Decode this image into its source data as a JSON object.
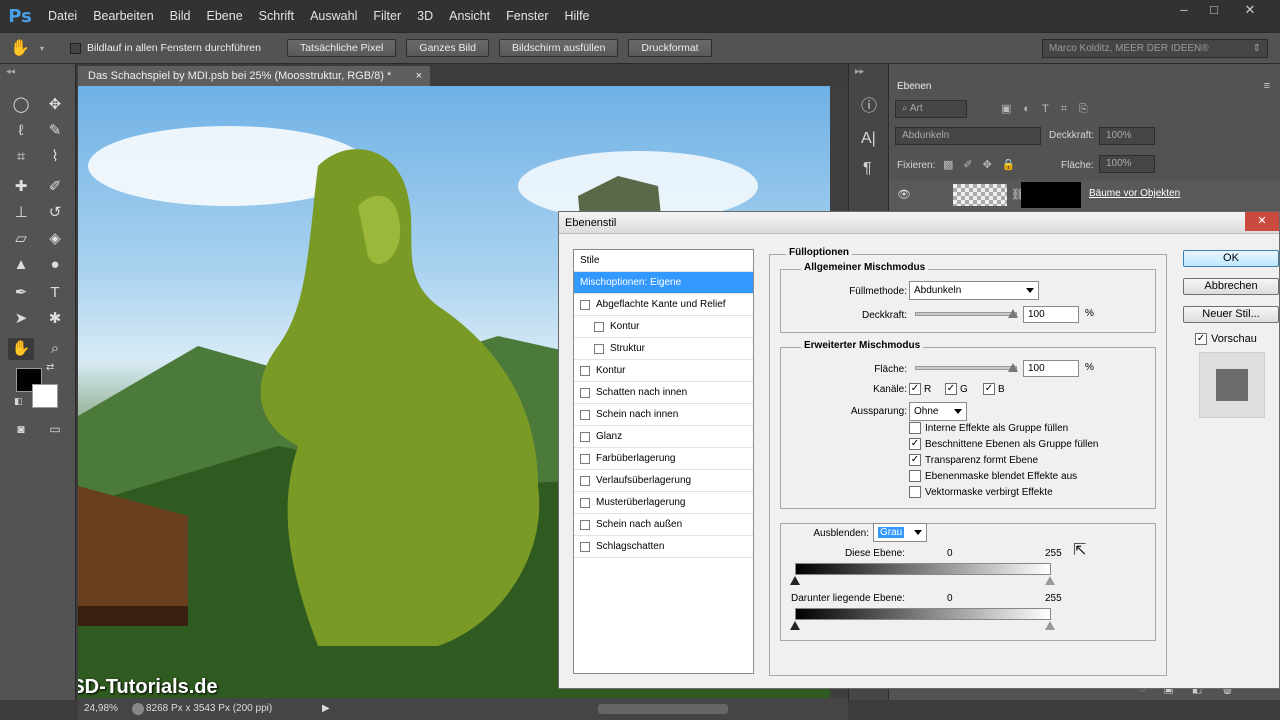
{
  "app": {
    "logo": "Ps"
  },
  "menu": [
    "Datei",
    "Bearbeiten",
    "Bild",
    "Ebene",
    "Schrift",
    "Auswahl",
    "Filter",
    "3D",
    "Ansicht",
    "Fenster",
    "Hilfe"
  ],
  "window_controls": {
    "minimize": "–",
    "maximize": "□",
    "close": "✕"
  },
  "options_bar": {
    "scroll_all_label": "Bildlauf in allen Fenstern durchführen",
    "buttons": [
      "Tatsächliche Pixel",
      "Ganzes Bild",
      "Bildschirm ausfüllen",
      "Druckformat"
    ],
    "workspace": "Marco Kolditz, MEER DER IDEEN®"
  },
  "document": {
    "tab_title": "Das Schachspiel by MDI.psb bei 25% (Moosstruktur, RGB/8) *",
    "close_symbol": "×",
    "watermark": "PSD-Tutorials.de"
  },
  "status_bar": {
    "zoom": "24,98%",
    "info": "8268 Px x 3543 Px (200 ppi)"
  },
  "layers_panel": {
    "title": "Ebenen",
    "filter_kind": "Art",
    "blend_mode": "Abdunkeln",
    "opacity_label": "Deckkraft:",
    "opacity_value": "100%",
    "lock_label": "Fixieren:",
    "fill_label": "Fläche:",
    "fill_value": "100%",
    "layer_name": "Bäume vor Objekten"
  },
  "dialog": {
    "title": "Ebenenstil",
    "close": "✕",
    "styles_header": "Stile",
    "styles": [
      {
        "label": "Mischoptionen: Eigene",
        "selected": true,
        "has_checkbox": false,
        "indent": 0
      },
      {
        "label": "Abgeflachte Kante und Relief",
        "selected": false,
        "has_checkbox": true,
        "indent": 0
      },
      {
        "label": "Kontur",
        "selected": false,
        "has_checkbox": true,
        "indent": 1
      },
      {
        "label": "Struktur",
        "selected": false,
        "has_checkbox": true,
        "indent": 1
      },
      {
        "label": "Kontur",
        "selected": false,
        "has_checkbox": true,
        "indent": 0
      },
      {
        "label": "Schatten nach innen",
        "selected": false,
        "has_checkbox": true,
        "indent": 0
      },
      {
        "label": "Schein nach innen",
        "selected": false,
        "has_checkbox": true,
        "indent": 0
      },
      {
        "label": "Glanz",
        "selected": false,
        "has_checkbox": true,
        "indent": 0
      },
      {
        "label": "Farbüberlagerung",
        "selected": false,
        "has_checkbox": true,
        "indent": 0
      },
      {
        "label": "Verlaufsüberlagerung",
        "selected": false,
        "has_checkbox": true,
        "indent": 0
      },
      {
        "label": "Musterüberlagerung",
        "selected": false,
        "has_checkbox": true,
        "indent": 0
      },
      {
        "label": "Schein nach außen",
        "selected": false,
        "has_checkbox": true,
        "indent": 0
      },
      {
        "label": "Schlagschatten",
        "selected": false,
        "has_checkbox": true,
        "indent": 0
      }
    ],
    "fill_options_title": "Fülloptionen",
    "general": {
      "title": "Allgemeiner Mischmodus",
      "blend_label": "Füllmethode:",
      "blend_value": "Abdunkeln",
      "opacity_label": "Deckkraft:",
      "opacity_value": "100",
      "percent": "%"
    },
    "advanced": {
      "title": "Erweiterter Mischmodus",
      "fill_label": "Fläche:",
      "fill_value": "100",
      "percent": "%",
      "channels_label": "Kanäle:",
      "channels": [
        {
          "label": "R",
          "checked": true
        },
        {
          "label": "G",
          "checked": true
        },
        {
          "label": "B",
          "checked": true
        }
      ],
      "knockout_label": "Aussparung:",
      "knockout_value": "Ohne",
      "options": [
        {
          "label": "Interne Effekte als Gruppe füllen",
          "checked": false
        },
        {
          "label": "Beschnittene Ebenen als Gruppe füllen",
          "checked": true
        },
        {
          "label": "Transparenz formt Ebene",
          "checked": true
        },
        {
          "label": "Ebenenmaske blendet Effekte aus",
          "checked": false
        },
        {
          "label": "Vektormaske verbirgt Effekte",
          "checked": false
        }
      ]
    },
    "blend_if": {
      "label": "Ausblenden:",
      "value": "Grau",
      "this_layer_label": "Diese Ebene:",
      "this_layer_min": "0",
      "this_layer_max": "255",
      "underlying_label": "Darunter liegende Ebene:",
      "underlying_min": "0",
      "underlying_max": "255"
    },
    "buttons": {
      "ok": "OK",
      "cancel": "Abbrechen",
      "new_style": "Neuer Stil..."
    },
    "preview_label": "Vorschau",
    "preview_checked": true
  }
}
